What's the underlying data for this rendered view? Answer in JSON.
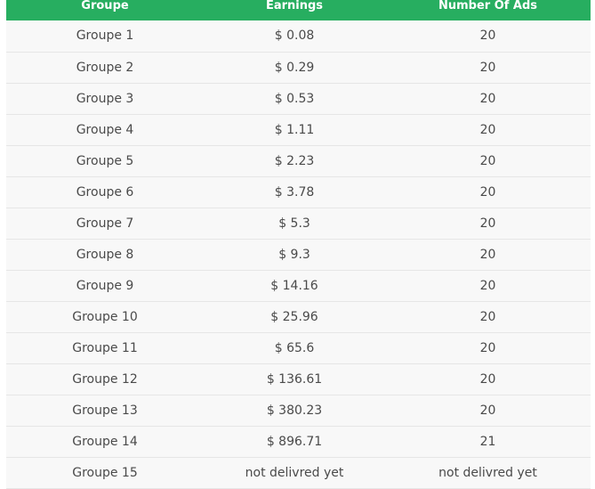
{
  "table": {
    "headers": [
      "Groupe",
      "Earnings",
      "Number Of Ads"
    ],
    "rows": [
      [
        "Groupe 1",
        "$ 0.08",
        "20"
      ],
      [
        "Groupe 2",
        "$ 0.29",
        "20"
      ],
      [
        "Groupe 3",
        "$ 0.53",
        "20"
      ],
      [
        "Groupe 4",
        "$ 1.11",
        "20"
      ],
      [
        "Groupe 5",
        "$ 2.23",
        "20"
      ],
      [
        "Groupe 6",
        "$ 3.78",
        "20"
      ],
      [
        "Groupe 7",
        "$ 5.3",
        "20"
      ],
      [
        "Groupe 8",
        "$ 9.3",
        "20"
      ],
      [
        "Groupe 9",
        "$ 14.16",
        "20"
      ],
      [
        "Groupe 10",
        "$ 25.96",
        "20"
      ],
      [
        "Groupe 11",
        "$ 65.6",
        "20"
      ],
      [
        "Groupe 12",
        "$ 136.61",
        "20"
      ],
      [
        "Groupe 13",
        "$ 380.23",
        "20"
      ],
      [
        "Groupe 14",
        "$ 896.71",
        "21"
      ],
      [
        "Groupe 15",
        "not delivred yet",
        "not delivred yet"
      ]
    ]
  },
  "colors": {
    "header_bg": "#27ae60",
    "header_text": "#ffffff",
    "row_bg": "#f8f8f8",
    "row_text": "#4a4a4a",
    "row_border": "#e6e6e6"
  }
}
